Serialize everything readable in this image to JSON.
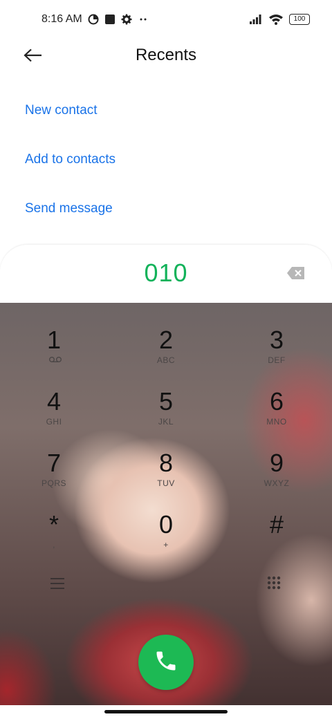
{
  "status_bar": {
    "time": "8:16 AM",
    "battery": "100",
    "left_icons": [
      "data-saver-icon",
      "square-app-icon",
      "settings-gear-icon",
      "more-dots-icon"
    ],
    "right_icons": [
      "signal-icon",
      "wifi-icon",
      "battery-icon"
    ]
  },
  "header": {
    "title": "Recents",
    "back_icon": "arrow-left-icon"
  },
  "actions": [
    {
      "label": "New contact"
    },
    {
      "label": "Add to contacts"
    },
    {
      "label": "Send message"
    }
  ],
  "dialer": {
    "number": "010",
    "number_color": "#12b25a",
    "backspace_icon": "backspace-icon",
    "keys": [
      {
        "digit": "1",
        "letters": "",
        "sub_icon": "voicemail-icon"
      },
      {
        "digit": "2",
        "letters": "ABC"
      },
      {
        "digit": "3",
        "letters": "DEF"
      },
      {
        "digit": "4",
        "letters": "GHI"
      },
      {
        "digit": "5",
        "letters": "JKL"
      },
      {
        "digit": "6",
        "letters": "MNO"
      },
      {
        "digit": "7",
        "letters": "PQRS"
      },
      {
        "digit": "8",
        "letters": "TUV"
      },
      {
        "digit": "9",
        "letters": "WXYZ"
      },
      {
        "digit": "*",
        "letters": ","
      },
      {
        "digit": "0",
        "letters": "+"
      },
      {
        "digit": "#",
        "letters": ""
      }
    ],
    "menu_icon": "menu-icon",
    "keypad_toggle_icon": "dialpad-icon",
    "call_icon": "phone-icon",
    "call_color": "#1db954"
  }
}
